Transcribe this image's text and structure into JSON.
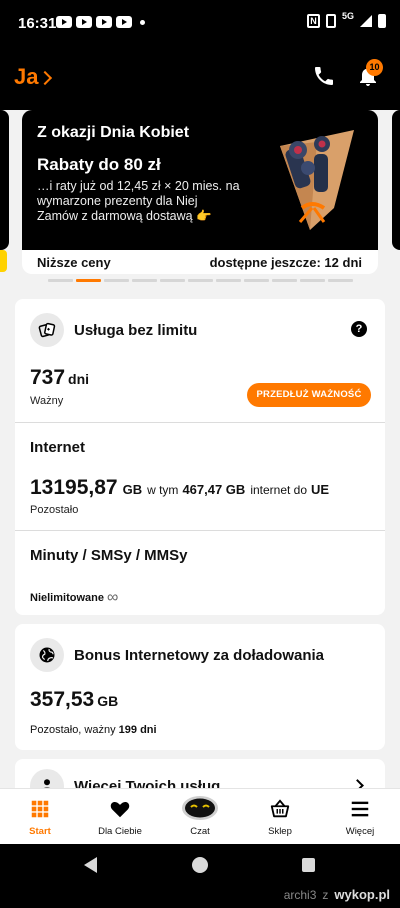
{
  "status_bar": {
    "time": "16:31",
    "network": "5G"
  },
  "header": {
    "title": "Ja",
    "notification_count": "10"
  },
  "banner": {
    "title": "Z okazji Dnia Kobiet",
    "subtitle": "Rabaty do 80 zł",
    "description": "…i raty już od 12,45 zł × 20 mies. na wymarzone prezenty dla Niej",
    "cta": "Zamów z darmową dostawą 👉",
    "footer_left": "Niższe ceny",
    "footer_right": "dostępne jeszcze: 12 dni",
    "pager": {
      "count": 11,
      "active_index": 1
    }
  },
  "plan_card": {
    "title": "Usługa bez limitu",
    "help": "?",
    "days_value": "737",
    "days_unit": "dni",
    "days_label": "Ważny",
    "extend_button": "PRZEDŁUŻ WAŻNOŚĆ",
    "internet": {
      "title": "Internet",
      "value": "13195,87",
      "unit": "GB",
      "in_text": "w tym",
      "eu_value": "467,47 GB",
      "eu_text": "internet do",
      "eu_label": "UE",
      "remaining_label": "Pozostało"
    },
    "minutes": {
      "title": "Minuty / SMSy / MMSy",
      "unlimited_label": "Nielimitowane",
      "infinity": "∞"
    }
  },
  "bonus_card": {
    "title": "Bonus Internetowy za doładowania",
    "value": "357,53",
    "unit": "GB",
    "remaining_prefix": "Pozostało, ważny",
    "remaining_days": "199 dni"
  },
  "services_card": {
    "title": "Więcej Twoich usług"
  },
  "bottom_nav": [
    {
      "label": "Start",
      "icon": "grid-icon",
      "active": true
    },
    {
      "label": "Dla Ciebie",
      "icon": "heart-icon",
      "active": false
    },
    {
      "label": "Czat",
      "icon": "chat-bot-icon",
      "active": false
    },
    {
      "label": "Sklep",
      "icon": "basket-icon",
      "active": false
    },
    {
      "label": "Więcej",
      "icon": "menu-icon",
      "active": false
    }
  ],
  "watermark": {
    "user": "archi3",
    "separator": "z",
    "site": "wykop.pl"
  },
  "colors": {
    "accent": "#ff7900",
    "background": "#f2f2f2",
    "dark": "#000000"
  }
}
